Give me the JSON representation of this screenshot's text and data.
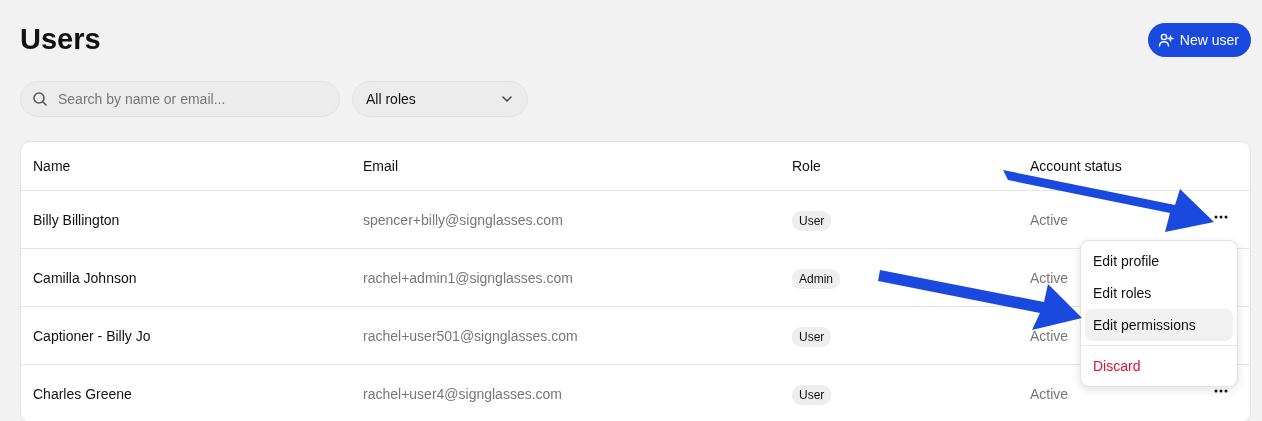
{
  "page": {
    "title": "Users"
  },
  "new_user_button": {
    "label": "New user"
  },
  "search": {
    "placeholder": "Search by name or email..."
  },
  "role_filter": {
    "value": "All roles"
  },
  "table": {
    "columns": [
      "Name",
      "Email",
      "Role",
      "Account status"
    ],
    "rows": [
      {
        "name": "Billy Billington",
        "email": "spencer+billy@signglasses.com",
        "role": "User",
        "status": "Active"
      },
      {
        "name": "Camilla Johnson",
        "email": "rachel+admin1@signglasses.com",
        "role": "Admin",
        "status": "Active"
      },
      {
        "name": "Captioner - Billy Jo",
        "email": "rachel+user501@signglasses.com",
        "role": "User",
        "status": "Active"
      },
      {
        "name": "Charles Greene",
        "email": "rachel+user4@signglasses.com",
        "role": "User",
        "status": "Active"
      }
    ]
  },
  "row_menu": {
    "items": [
      {
        "label": "Edit profile",
        "kind": "normal",
        "selected": false
      },
      {
        "label": "Edit roles",
        "kind": "normal",
        "selected": false
      },
      {
        "label": "Edit permissions",
        "kind": "normal",
        "selected": true
      },
      {
        "label": "Discard",
        "kind": "danger",
        "selected": false
      }
    ]
  }
}
